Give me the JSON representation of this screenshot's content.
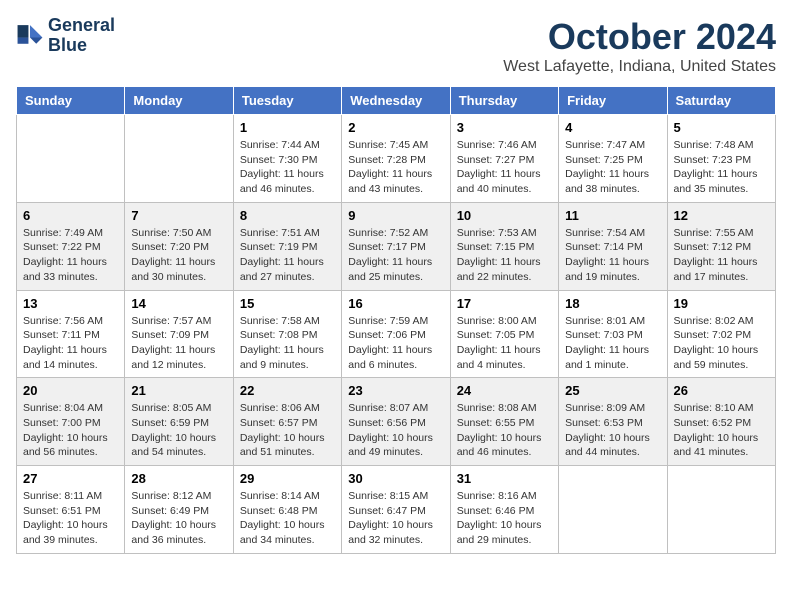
{
  "header": {
    "logo_line1": "General",
    "logo_line2": "Blue",
    "title": "October 2024",
    "subtitle": "West Lafayette, Indiana, United States"
  },
  "weekdays": [
    "Sunday",
    "Monday",
    "Tuesday",
    "Wednesday",
    "Thursday",
    "Friday",
    "Saturday"
  ],
  "weeks": [
    [
      {
        "day": "",
        "info": ""
      },
      {
        "day": "",
        "info": ""
      },
      {
        "day": "1",
        "info": "Sunrise: 7:44 AM\nSunset: 7:30 PM\nDaylight: 11 hours and 46 minutes."
      },
      {
        "day": "2",
        "info": "Sunrise: 7:45 AM\nSunset: 7:28 PM\nDaylight: 11 hours and 43 minutes."
      },
      {
        "day": "3",
        "info": "Sunrise: 7:46 AM\nSunset: 7:27 PM\nDaylight: 11 hours and 40 minutes."
      },
      {
        "day": "4",
        "info": "Sunrise: 7:47 AM\nSunset: 7:25 PM\nDaylight: 11 hours and 38 minutes."
      },
      {
        "day": "5",
        "info": "Sunrise: 7:48 AM\nSunset: 7:23 PM\nDaylight: 11 hours and 35 minutes."
      }
    ],
    [
      {
        "day": "6",
        "info": "Sunrise: 7:49 AM\nSunset: 7:22 PM\nDaylight: 11 hours and 33 minutes."
      },
      {
        "day": "7",
        "info": "Sunrise: 7:50 AM\nSunset: 7:20 PM\nDaylight: 11 hours and 30 minutes."
      },
      {
        "day": "8",
        "info": "Sunrise: 7:51 AM\nSunset: 7:19 PM\nDaylight: 11 hours and 27 minutes."
      },
      {
        "day": "9",
        "info": "Sunrise: 7:52 AM\nSunset: 7:17 PM\nDaylight: 11 hours and 25 minutes."
      },
      {
        "day": "10",
        "info": "Sunrise: 7:53 AM\nSunset: 7:15 PM\nDaylight: 11 hours and 22 minutes."
      },
      {
        "day": "11",
        "info": "Sunrise: 7:54 AM\nSunset: 7:14 PM\nDaylight: 11 hours and 19 minutes."
      },
      {
        "day": "12",
        "info": "Sunrise: 7:55 AM\nSunset: 7:12 PM\nDaylight: 11 hours and 17 minutes."
      }
    ],
    [
      {
        "day": "13",
        "info": "Sunrise: 7:56 AM\nSunset: 7:11 PM\nDaylight: 11 hours and 14 minutes."
      },
      {
        "day": "14",
        "info": "Sunrise: 7:57 AM\nSunset: 7:09 PM\nDaylight: 11 hours and 12 minutes."
      },
      {
        "day": "15",
        "info": "Sunrise: 7:58 AM\nSunset: 7:08 PM\nDaylight: 11 hours and 9 minutes."
      },
      {
        "day": "16",
        "info": "Sunrise: 7:59 AM\nSunset: 7:06 PM\nDaylight: 11 hours and 6 minutes."
      },
      {
        "day": "17",
        "info": "Sunrise: 8:00 AM\nSunset: 7:05 PM\nDaylight: 11 hours and 4 minutes."
      },
      {
        "day": "18",
        "info": "Sunrise: 8:01 AM\nSunset: 7:03 PM\nDaylight: 11 hours and 1 minute."
      },
      {
        "day": "19",
        "info": "Sunrise: 8:02 AM\nSunset: 7:02 PM\nDaylight: 10 hours and 59 minutes."
      }
    ],
    [
      {
        "day": "20",
        "info": "Sunrise: 8:04 AM\nSunset: 7:00 PM\nDaylight: 10 hours and 56 minutes."
      },
      {
        "day": "21",
        "info": "Sunrise: 8:05 AM\nSunset: 6:59 PM\nDaylight: 10 hours and 54 minutes."
      },
      {
        "day": "22",
        "info": "Sunrise: 8:06 AM\nSunset: 6:57 PM\nDaylight: 10 hours and 51 minutes."
      },
      {
        "day": "23",
        "info": "Sunrise: 8:07 AM\nSunset: 6:56 PM\nDaylight: 10 hours and 49 minutes."
      },
      {
        "day": "24",
        "info": "Sunrise: 8:08 AM\nSunset: 6:55 PM\nDaylight: 10 hours and 46 minutes."
      },
      {
        "day": "25",
        "info": "Sunrise: 8:09 AM\nSunset: 6:53 PM\nDaylight: 10 hours and 44 minutes."
      },
      {
        "day": "26",
        "info": "Sunrise: 8:10 AM\nSunset: 6:52 PM\nDaylight: 10 hours and 41 minutes."
      }
    ],
    [
      {
        "day": "27",
        "info": "Sunrise: 8:11 AM\nSunset: 6:51 PM\nDaylight: 10 hours and 39 minutes."
      },
      {
        "day": "28",
        "info": "Sunrise: 8:12 AM\nSunset: 6:49 PM\nDaylight: 10 hours and 36 minutes."
      },
      {
        "day": "29",
        "info": "Sunrise: 8:14 AM\nSunset: 6:48 PM\nDaylight: 10 hours and 34 minutes."
      },
      {
        "day": "30",
        "info": "Sunrise: 8:15 AM\nSunset: 6:47 PM\nDaylight: 10 hours and 32 minutes."
      },
      {
        "day": "31",
        "info": "Sunrise: 8:16 AM\nSunset: 6:46 PM\nDaylight: 10 hours and 29 minutes."
      },
      {
        "day": "",
        "info": ""
      },
      {
        "day": "",
        "info": ""
      }
    ]
  ]
}
